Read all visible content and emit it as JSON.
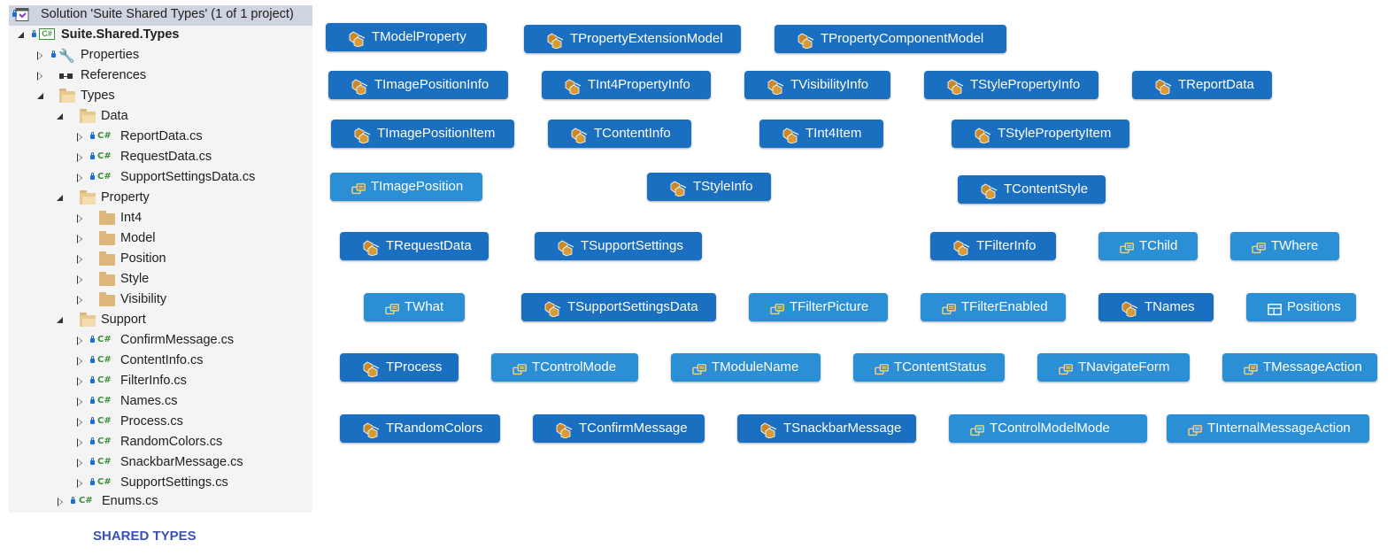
{
  "solution_explorer": {
    "rows": [
      {
        "text": "Solution 'Suite Shared Types' (1 of 1 project)"
      },
      {
        "text": "Suite.Shared.Types"
      },
      {
        "text": "Properties"
      },
      {
        "text": "References"
      },
      {
        "text": "Types"
      },
      {
        "text": "Data"
      },
      {
        "text": "ReportData.cs"
      },
      {
        "text": "RequestData.cs"
      },
      {
        "text": "SupportSettingsData.cs"
      },
      {
        "text": "Property"
      },
      {
        "text": "Int4"
      },
      {
        "text": "Model"
      },
      {
        "text": "Position"
      },
      {
        "text": "Style"
      },
      {
        "text": "Visibility"
      },
      {
        "text": "Support"
      },
      {
        "text": "ConfirmMessage.cs"
      },
      {
        "text": "ContentInfo.cs"
      },
      {
        "text": "FilterInfo.cs"
      },
      {
        "text": "Names.cs"
      },
      {
        "text": "Process.cs"
      },
      {
        "text": "RandomColors.cs"
      },
      {
        "text": "SnackbarMessage.cs"
      },
      {
        "text": "SupportSettings.cs"
      },
      {
        "text": "Enums.cs"
      }
    ],
    "csharp_badge": "C#"
  },
  "caption": "SHARED TYPES",
  "types": [
    {
      "name": "TModelProperty",
      "icon": "class-icon"
    },
    {
      "name": "TPropertyExtensionModel",
      "icon": "class-icon"
    },
    {
      "name": "TPropertyComponentModel",
      "icon": "class-icon"
    },
    {
      "name": "TImagePositionInfo",
      "icon": "class-icon"
    },
    {
      "name": "TInt4PropertyInfo",
      "icon": "class-icon"
    },
    {
      "name": "TVisibilityInfo",
      "icon": "class-icon"
    },
    {
      "name": "TStylePropertyInfo",
      "icon": "class-icon"
    },
    {
      "name": "TReportData",
      "icon": "class-icon"
    },
    {
      "name": "TImagePositionItem",
      "icon": "class-icon"
    },
    {
      "name": "TContentInfo",
      "icon": "class-icon"
    },
    {
      "name": "TInt4Item",
      "icon": "class-icon"
    },
    {
      "name": "TStylePropertyItem",
      "icon": "class-icon"
    },
    {
      "name": "TImagePosition",
      "icon": "enum-icon"
    },
    {
      "name": "TStyleInfo",
      "icon": "class-icon"
    },
    {
      "name": "TContentStyle",
      "icon": "class-icon"
    },
    {
      "name": "TRequestData",
      "icon": "class-icon"
    },
    {
      "name": "TSupportSettings",
      "icon": "class-icon"
    },
    {
      "name": "TFilterInfo",
      "icon": "class-icon"
    },
    {
      "name": "TChild",
      "icon": "enum-icon"
    },
    {
      "name": "TWhere",
      "icon": "enum-icon"
    },
    {
      "name": "TWhat",
      "icon": "enum-icon"
    },
    {
      "name": "TSupportSettingsData",
      "icon": "class-icon"
    },
    {
      "name": "TFilterPicture",
      "icon": "enum-icon"
    },
    {
      "name": "TFilterEnabled",
      "icon": "enum-icon"
    },
    {
      "name": "TNames",
      "icon": "class-icon"
    },
    {
      "name": "Positions",
      "icon": "static-class-icon"
    },
    {
      "name": "TProcess",
      "icon": "class-icon"
    },
    {
      "name": "TControlMode",
      "icon": "enum-icon"
    },
    {
      "name": "TModuleName",
      "icon": "enum-icon"
    },
    {
      "name": "TContentStatus",
      "icon": "enum-icon"
    },
    {
      "name": "TNavigateForm",
      "icon": "enum-icon"
    },
    {
      "name": "TMessageAction",
      "icon": "enum-icon"
    },
    {
      "name": "TRandomColors",
      "icon": "class-icon"
    },
    {
      "name": "TConfirmMessage",
      "icon": "class-icon"
    },
    {
      "name": "TSnackbarMessage",
      "icon": "class-icon"
    },
    {
      "name": "TControlModelMode",
      "icon": "enum-icon"
    },
    {
      "name": "TInternalMessageAction",
      "icon": "enum-icon"
    }
  ]
}
